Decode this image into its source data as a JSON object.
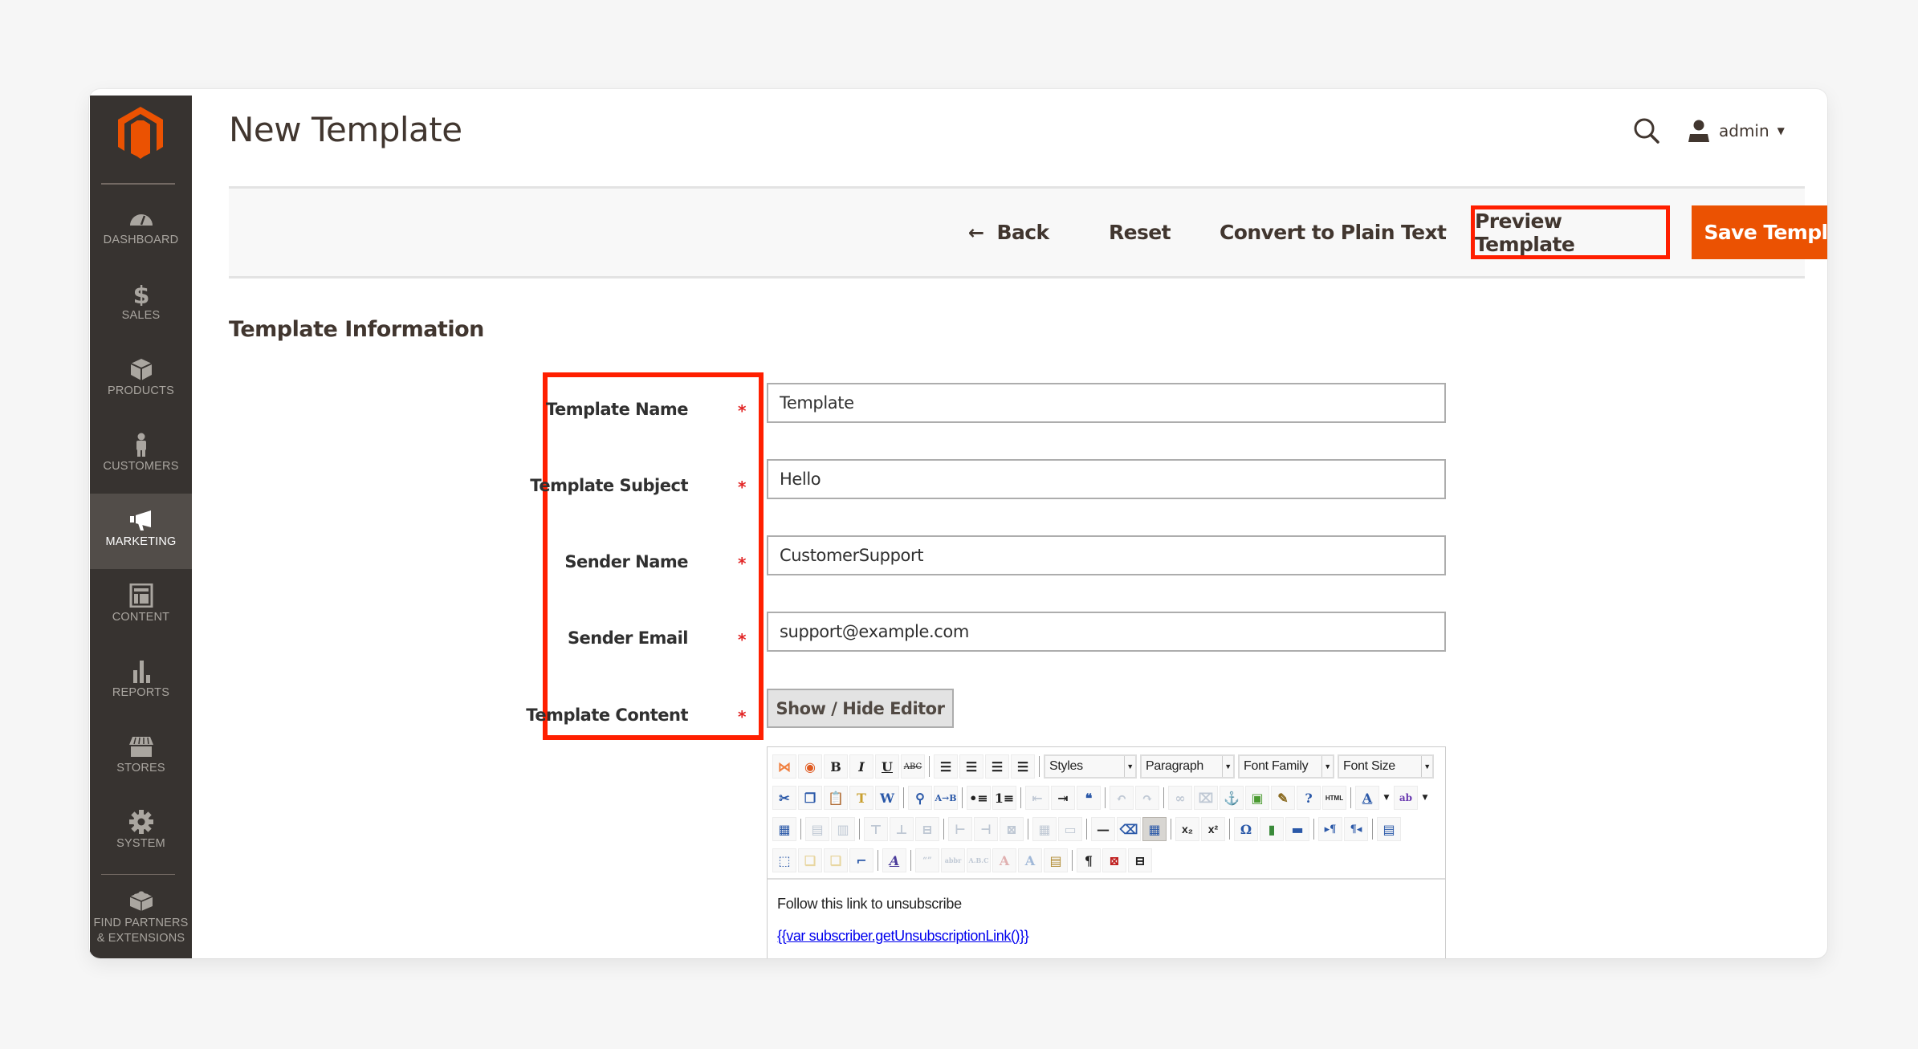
{
  "colors": {
    "sidebar_bg": "#373330",
    "sidebar_active_bg": "#524d49",
    "brand_orange": "#eb5202",
    "highlight_red": "#ff1f00",
    "required_star": "#e22626"
  },
  "sidebar": {
    "logo": "magento-logo",
    "items": [
      {
        "label": "DASHBOARD",
        "icon": "dashboard-icon",
        "active": false
      },
      {
        "label": "SALES",
        "icon": "dollar-icon",
        "active": false
      },
      {
        "label": "PRODUCTS",
        "icon": "box-icon",
        "active": false
      },
      {
        "label": "CUSTOMERS",
        "icon": "person-icon",
        "active": false
      },
      {
        "label": "MARKETING",
        "icon": "megaphone-icon",
        "active": true
      },
      {
        "label": "CONTENT",
        "icon": "layout-icon",
        "active": false
      },
      {
        "label": "REPORTS",
        "icon": "bar-chart-icon",
        "active": false
      },
      {
        "label": "STORES",
        "icon": "storefront-icon",
        "active": false
      },
      {
        "label": "SYSTEM",
        "icon": "gear-icon",
        "active": false
      },
      {
        "label_line1": "FIND PARTNERS",
        "label_line2": "& EXTENSIONS",
        "icon": "blocks-icon",
        "active": false
      }
    ]
  },
  "header": {
    "title": "New Template",
    "search_icon": "search-icon",
    "user_label": "admin",
    "user_icon": "user-icon"
  },
  "actions": {
    "back_label": "Back",
    "reset_label": "Reset",
    "convert_label": "Convert to Plain Text",
    "preview_label": "Preview Template",
    "save_label": "Save Template"
  },
  "section": {
    "title": "Template Information"
  },
  "form": {
    "fields": [
      {
        "label": "Template Name",
        "value": "Template",
        "required": true
      },
      {
        "label": "Template Subject",
        "value": "Hello",
        "required": true
      },
      {
        "label": "Sender Name",
        "value": "CustomerSupport",
        "required": true
      },
      {
        "label": "Sender Email",
        "value": "support@example.com",
        "required": true
      },
      {
        "label": "Template Content",
        "required": true
      }
    ],
    "required_mark": "*",
    "toggle_editor_label": "Show / Hide Editor"
  },
  "editor": {
    "selects": {
      "styles": "Styles",
      "paragraph": "Paragraph",
      "font_family": "Font Family",
      "font_size": "Font Size"
    },
    "buttons": {
      "bold": "B",
      "italic": "I",
      "underline": "U",
      "strike": "ABC",
      "html": "HTML",
      "subscript": "x₂",
      "superscript": "x²",
      "omega": "Ω",
      "pilcrow": "¶"
    },
    "content_text": "Follow this link to unsubscribe",
    "content_link": "{{var subscriber.getUnsubscriptionLink()}}"
  }
}
